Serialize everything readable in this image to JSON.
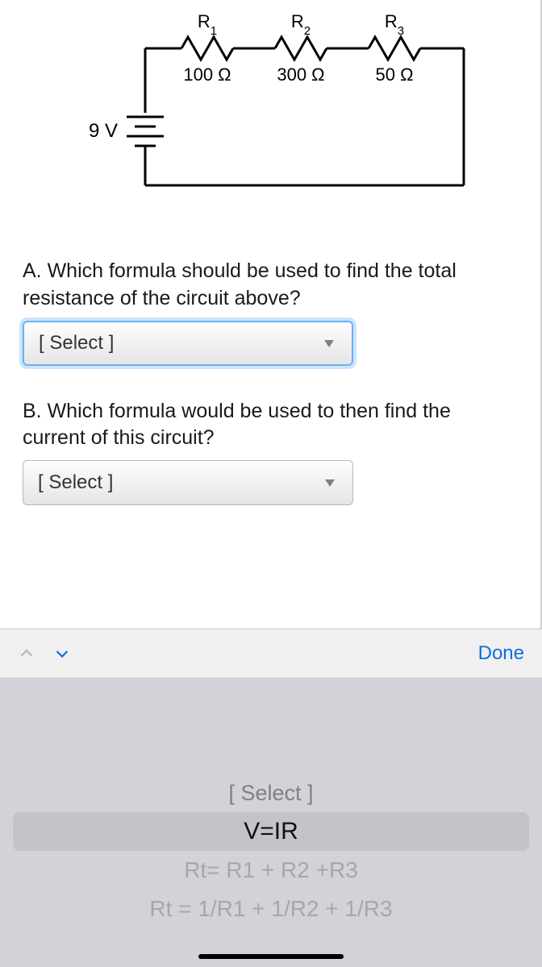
{
  "circuit": {
    "voltage_label": "9 V",
    "resistors": [
      {
        "name": "R",
        "sub": "1",
        "value": "100 Ω"
      },
      {
        "name": "R",
        "sub": "2",
        "value": "300 Ω"
      },
      {
        "name": "R",
        "sub": "3",
        "value": "50 Ω"
      }
    ]
  },
  "question_a": "A. Which formula should be used to find the total resistance of the circuit above?",
  "question_b": "B. Which formula would be used to then find the current of this circuit?",
  "select_placeholder": "[ Select ]",
  "toolbar": {
    "done": "Done"
  },
  "picker": {
    "options": [
      "[ Select ]",
      "V=IR",
      "Rt= R1 + R2 +R3",
      "Rt = 1/R1 + 1/R2 + 1/R3"
    ],
    "selected_index": 1
  }
}
